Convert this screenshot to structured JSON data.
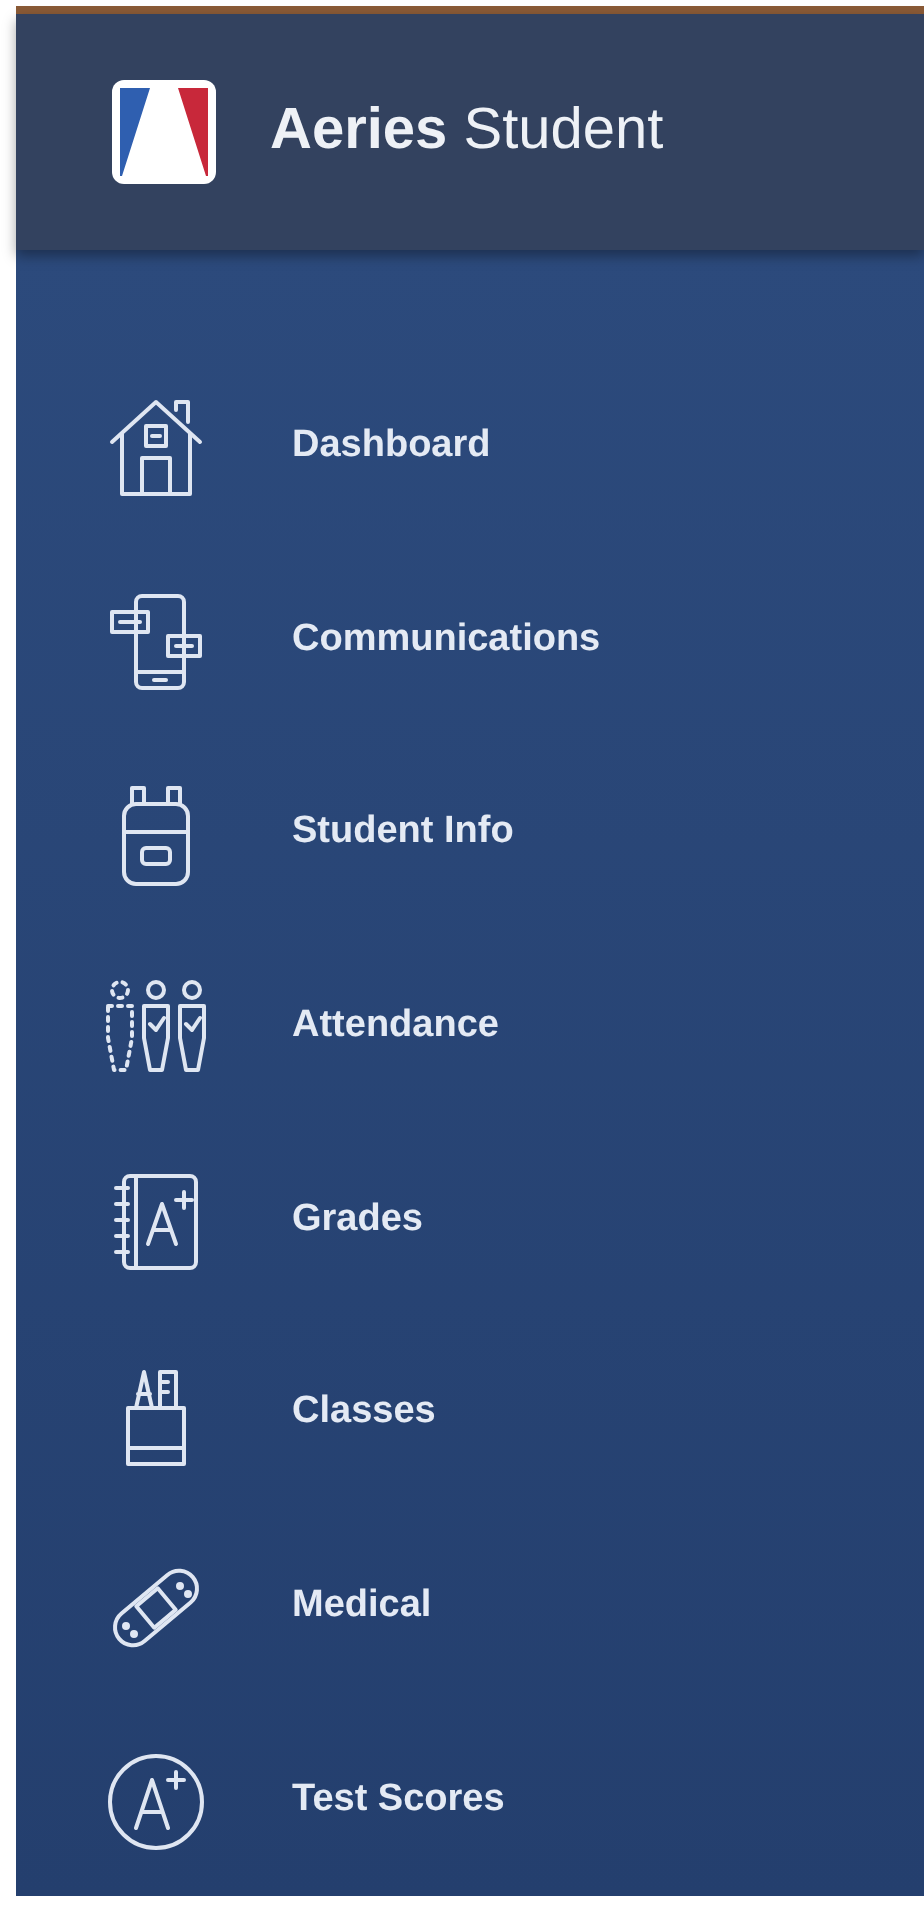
{
  "header": {
    "title": "**Aeries** Student"
  },
  "nav": {
    "items": [
      {
        "label": "Dashboard"
      },
      {
        "label": "Communications"
      },
      {
        "label": "Student Info"
      },
      {
        "label": "Attendance"
      },
      {
        "label": "Grades"
      },
      {
        "label": "Classes"
      },
      {
        "label": "Medical"
      },
      {
        "label": "Test Scores"
      }
    ]
  }
}
